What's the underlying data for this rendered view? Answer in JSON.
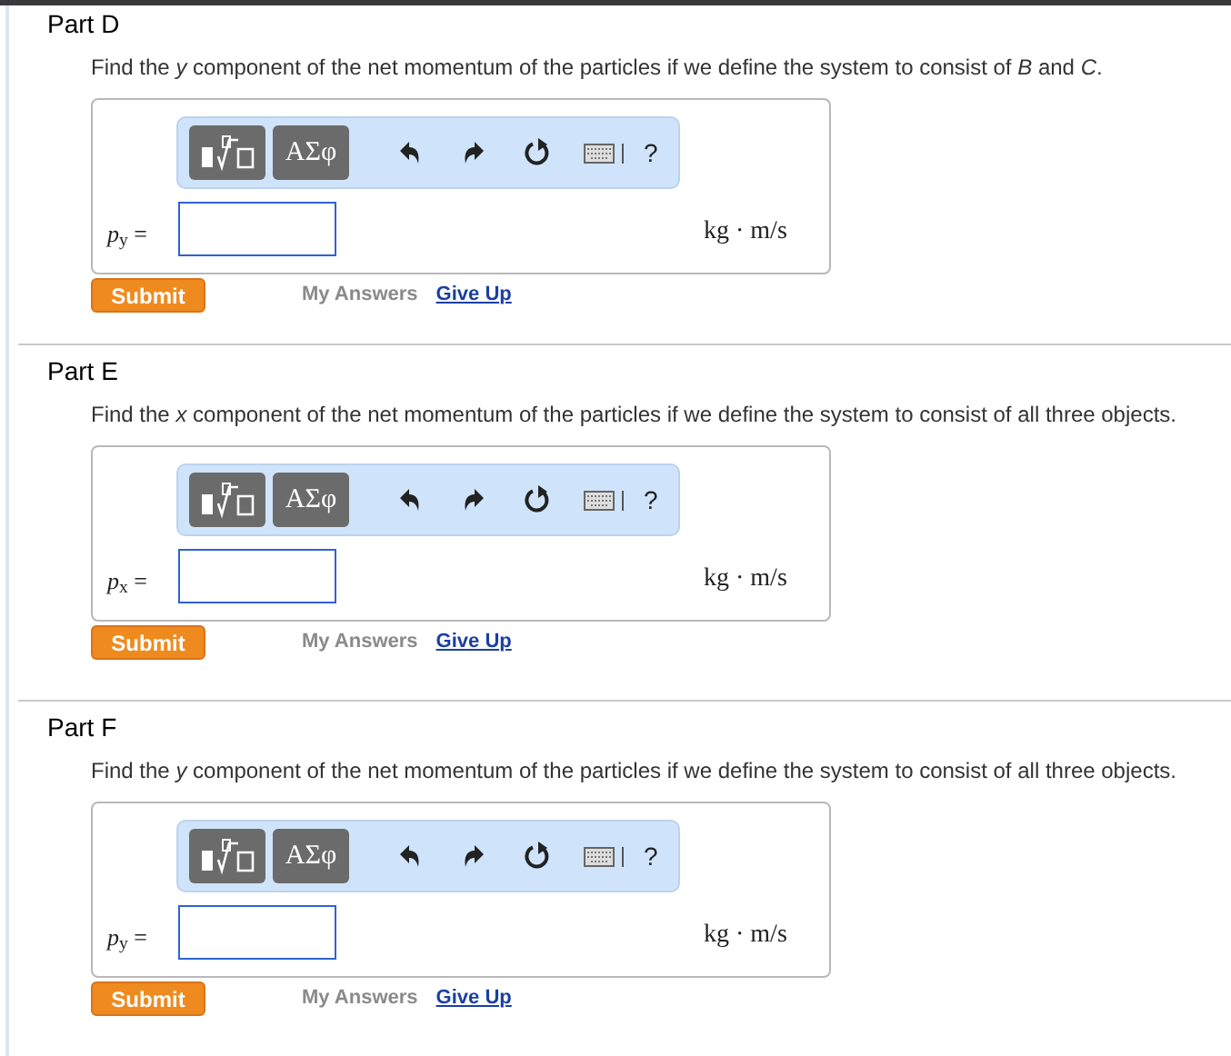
{
  "parts": [
    {
      "title": "Part D",
      "question": "Find the *y* component of the net momentum of the particles if we define the system to consist of *B* and *C*.",
      "toolbar": {
        "symbols": "ΑΣφ",
        "help": "?"
      },
      "label": "*p*$_{y}$ =",
      "unit": "kg · m/s",
      "submit": "Submit",
      "my_answers": "My Answers",
      "give_up": "Give Up"
    },
    {
      "title": "Part E",
      "question": "Find the *x* component of the net momentum of the particles if we define the system to consist of all three objects.",
      "toolbar": {
        "symbols": "ΑΣφ",
        "help": "?"
      },
      "label": "*p*$_{x}$ =",
      "unit": "kg · m/s",
      "submit": "Submit",
      "my_answers": "My Answers",
      "give_up": "Give Up"
    },
    {
      "title": "Part F",
      "question": "Find the *y* component of the net momentum of the particles if we define the system to consist of all three objects.",
      "toolbar": {
        "symbols": "ΑΣφ",
        "help": "?"
      },
      "label": "*p*$_{y}$ =",
      "unit": "kg · m/s",
      "submit": "Submit",
      "my_answers": "My Answers",
      "give_up": "Give Up"
    }
  ]
}
